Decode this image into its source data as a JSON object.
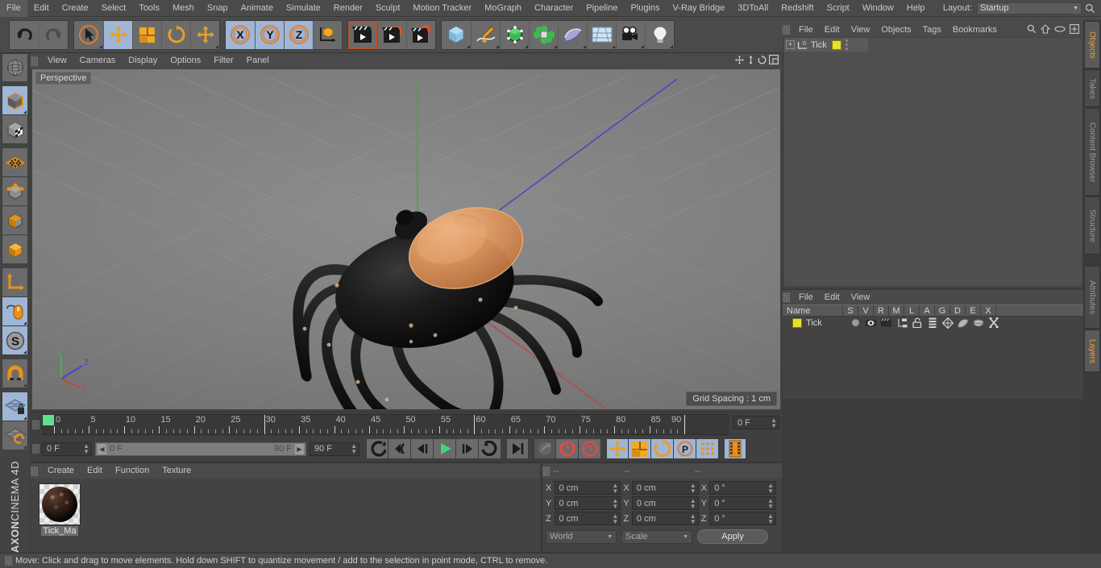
{
  "app": {
    "name": "MAXON",
    "product": "CINEMA 4D"
  },
  "menubar": {
    "items": [
      "File",
      "Edit",
      "Create",
      "Select",
      "Tools",
      "Mesh",
      "Snap",
      "Animate",
      "Simulate",
      "Render",
      "Sculpt",
      "Motion Tracker",
      "MoGraph",
      "Character",
      "Pipeline",
      "Plugins",
      "V-Ray Bridge",
      "3DToAll",
      "Redshift",
      "Script",
      "Window",
      "Help"
    ],
    "layout_label": "Layout:",
    "layout_value": "Startup",
    "search_icon": "search-icon"
  },
  "toolbar": {
    "groups": [
      {
        "name": "history",
        "buttons": [
          {
            "name": "undo-button",
            "icon": "undo-arrow-icon",
            "selected": false,
            "disabled": false
          },
          {
            "name": "redo-button",
            "icon": "redo-arrow-icon",
            "selected": false,
            "disabled": true
          }
        ]
      },
      {
        "name": "transform",
        "buttons": [
          {
            "name": "live-selection-tool",
            "icon": "cursor-circle-icon",
            "selected": false,
            "corner": true
          },
          {
            "name": "move-tool",
            "icon": "move-cross-icon",
            "selected": true
          },
          {
            "name": "scale-tool",
            "icon": "scale-box-icon",
            "selected": false
          },
          {
            "name": "rotate-tool",
            "icon": "rotate-circle-icon",
            "selected": false
          },
          {
            "name": "free-move-tool",
            "icon": "move-cross-icon",
            "selected": false,
            "corner": true
          }
        ]
      },
      {
        "name": "axis-lock",
        "buttons": [
          {
            "name": "lock-x-axis",
            "icon": "x-axis-icon",
            "label": "X",
            "selected": true
          },
          {
            "name": "lock-y-axis",
            "icon": "y-axis-icon",
            "label": "Y",
            "selected": true
          },
          {
            "name": "lock-z-axis",
            "icon": "z-axis-icon",
            "label": "Z",
            "selected": true
          },
          {
            "name": "world-object-coordinates",
            "icon": "axis-cube-icon",
            "selected": false
          }
        ]
      },
      {
        "name": "render",
        "buttons": [
          {
            "name": "render-view-button",
            "icon": "clapper-icon",
            "selected": false,
            "active": true
          },
          {
            "name": "render-to-picture-viewer",
            "icon": "clapper-picture-icon",
            "selected": false
          },
          {
            "name": "render-settings-button",
            "icon": "clapper-gear-icon",
            "selected": false
          }
        ]
      },
      {
        "name": "create",
        "buttons": [
          {
            "name": "add-cube-object",
            "icon": "blue-cube-icon",
            "selected": false,
            "corner": true
          },
          {
            "name": "add-spline-object",
            "icon": "pen-spline-icon",
            "selected": false,
            "corner": true
          },
          {
            "name": "add-generator-object",
            "icon": "green-cube-icon",
            "selected": false,
            "corner": true
          },
          {
            "name": "add-deformer-object",
            "icon": "green-cluster-icon",
            "selected": false,
            "corner": true
          },
          {
            "name": "add-scene-object",
            "icon": "bend-shape-icon",
            "selected": false,
            "corner": true
          },
          {
            "name": "add-floor-object",
            "icon": "floor-grid-icon",
            "selected": false,
            "corner": true
          },
          {
            "name": "add-camera-object",
            "icon": "camera-icon",
            "selected": false,
            "corner": true
          },
          {
            "name": "add-light-object",
            "icon": "lightbulb-icon",
            "selected": false,
            "corner": true
          }
        ]
      }
    ]
  },
  "left_toolbar": {
    "buttons": [
      {
        "name": "texture-axis-mode",
        "icon": "globe-wireframe-icon",
        "selected": false
      },
      {
        "name": "object-mode",
        "icon": "orange-cube-icon",
        "selected": true,
        "corner": true
      },
      {
        "name": "texture-mode",
        "icon": "checker-cube-icon",
        "selected": false
      },
      {
        "name": "points-mode",
        "icon": "points-mesh-icon",
        "selected": false
      },
      {
        "name": "edges-mode",
        "icon": "edges-cube-icon",
        "selected": false
      },
      {
        "name": "polygons-mode",
        "icon": "polygon-cube-icon",
        "selected": false
      },
      {
        "name": "model-mode",
        "icon": "solid-cube-icon",
        "selected": false
      },
      {
        "name": "axis-modify-mode",
        "icon": "axis-arrow-icon",
        "selected": false
      },
      {
        "name": "viewport-solo-mode",
        "icon": "mouse-icon",
        "selected": true,
        "corner": true
      },
      {
        "name": "snap-settings",
        "icon": "s-circle-icon",
        "selected": true,
        "corner": true
      },
      {
        "name": "enable-snap",
        "icon": "magnet-icon",
        "selected": false,
        "corner": true
      },
      {
        "name": "workplane-lock",
        "icon": "grid-lock-icon",
        "selected": true,
        "corner": true
      },
      {
        "name": "workplane-rotate",
        "icon": "grid-rotate-icon",
        "selected": false,
        "corner": true
      }
    ]
  },
  "viewport": {
    "menu": [
      "View",
      "Cameras",
      "Display",
      "Options",
      "Filter",
      "Panel"
    ],
    "nav_icons": [
      "pan-icon",
      "zoom-icon",
      "rotate-icon",
      "maximize-icon"
    ],
    "label": "Perspective",
    "grid_spacing": "Grid Spacing : 1 cm",
    "axis_gizmo": {
      "x": "X",
      "y": "Y",
      "z": "Z"
    }
  },
  "timeline": {
    "ticks": [
      0,
      5,
      10,
      15,
      20,
      25,
      30,
      35,
      40,
      45,
      50,
      55,
      60,
      65,
      70,
      75,
      80,
      85,
      90
    ],
    "min": 0,
    "max": 90,
    "current_frame_field": "0 F",
    "playhead_frame": 0
  },
  "transport": {
    "current_frame": "0 F",
    "range_start": "0 F",
    "range_end": "90 F",
    "end_frame": "90 F",
    "buttons": [
      {
        "name": "go-to-start-button",
        "icon": "skip-start-icon",
        "selected": false
      },
      {
        "name": "play-backwards-loop-button",
        "icon": "loop-back-icon",
        "selected": false
      },
      {
        "name": "step-back-button",
        "icon": "step-back-icon",
        "selected": false
      },
      {
        "name": "play-forward-button",
        "icon": "play-icon",
        "selected": false
      },
      {
        "name": "step-forward-button",
        "icon": "step-forward-icon",
        "selected": false
      },
      {
        "name": "play-forward-loop-button",
        "icon": "loop-forward-icon",
        "selected": false
      },
      {
        "name": "go-to-end-button",
        "icon": "skip-end-icon",
        "selected": false
      },
      {
        "name": "record-active-objects-button",
        "icon": "key-icon",
        "selected": false,
        "disabled": true
      },
      {
        "name": "autokeying-button",
        "icon": "record-circle-icon",
        "selected": false
      },
      {
        "name": "keyframe-selection-button",
        "icon": "question-circle-icon",
        "selected": false
      },
      {
        "name": "position-key-button",
        "icon": "move-cross-icon",
        "selected": true
      },
      {
        "name": "scale-key-button",
        "icon": "scale-box-icon",
        "selected": true
      },
      {
        "name": "rotation-key-button",
        "icon": "rotate-circle-icon",
        "selected": true
      },
      {
        "name": "parameter-key-button",
        "icon": "p-circle-icon",
        "selected": true
      },
      {
        "name": "point-level-animation-button",
        "icon": "dot-matrix-icon",
        "selected": true
      },
      {
        "name": "timeline-toggle-button",
        "icon": "filmstrip-icon",
        "selected": true
      }
    ]
  },
  "materials": {
    "menu": [
      "Create",
      "Edit",
      "Function",
      "Texture"
    ],
    "items": [
      {
        "name": "Tick_Ma",
        "icon": "material-sphere-icon"
      }
    ]
  },
  "coordinates": {
    "headers": [
      "--",
      "--",
      "--"
    ],
    "rows": [
      {
        "axis": "X",
        "position": "0 cm",
        "size": "0 cm",
        "rotation": "0 °"
      },
      {
        "axis": "Y",
        "position": "0 cm",
        "size": "0 cm",
        "rotation": "0 °"
      },
      {
        "axis": "Z",
        "position": "0 cm",
        "size": "0 cm",
        "rotation": "0 °"
      }
    ],
    "coordinate_system": "World",
    "transform_mode": "Scale",
    "apply_label": "Apply"
  },
  "objects_panel": {
    "menu": [
      "File",
      "Edit",
      "View",
      "Objects",
      "Tags",
      "Bookmarks"
    ],
    "tools": [
      "search-icon",
      "home-icon",
      "ellipse-icon",
      "plus-box-icon"
    ],
    "items": [
      {
        "name": "Tick",
        "icon": "polygon-object-icon",
        "tag_color": "#e5e02a",
        "expandable": true
      }
    ]
  },
  "layers_panel": {
    "menu": [
      "File",
      "Edit",
      "View"
    ],
    "columns": [
      "Name",
      "S",
      "V",
      "R",
      "M",
      "L",
      "A",
      "G",
      "D",
      "E",
      "X"
    ],
    "rows": [
      {
        "name": "Tick",
        "color": "#e5e02a",
        "icons": [
          "solo-dot-icon",
          "visible-eye-icon",
          "render-clapper-icon",
          "manager-tree-icon",
          "lock-open-icon",
          "animation-bars-icon",
          "generators-icon",
          "deformers-icon",
          "expressions-icon",
          "xref-icon"
        ]
      }
    ]
  },
  "vertical_tabs": {
    "top": [
      {
        "label": "Objects",
        "active": true
      },
      {
        "label": "Takes",
        "active": false
      },
      {
        "label": "Content Browser",
        "active": false
      },
      {
        "label": "Structure",
        "active": false
      }
    ],
    "bottom": [
      {
        "label": "Attributes",
        "active": false
      },
      {
        "label": "Layers",
        "active": true
      }
    ]
  },
  "statusbar": {
    "text": "Move: Click and drag to move elements. Hold down SHIFT to quantize movement / add to the selection in point mode, CTRL to remove."
  },
  "colors": {
    "accent_orange": "#e8a13c",
    "selected_blue": "#9fb6d6",
    "panel_bg": "#434343",
    "toolbar_bg": "#4a4a4a",
    "tag_yellow": "#e5e02a",
    "play_green": "#4fd07a",
    "axis_x_red": "#cc4444",
    "axis_y_green": "#44bb44",
    "axis_z_blue": "#4444cc"
  }
}
